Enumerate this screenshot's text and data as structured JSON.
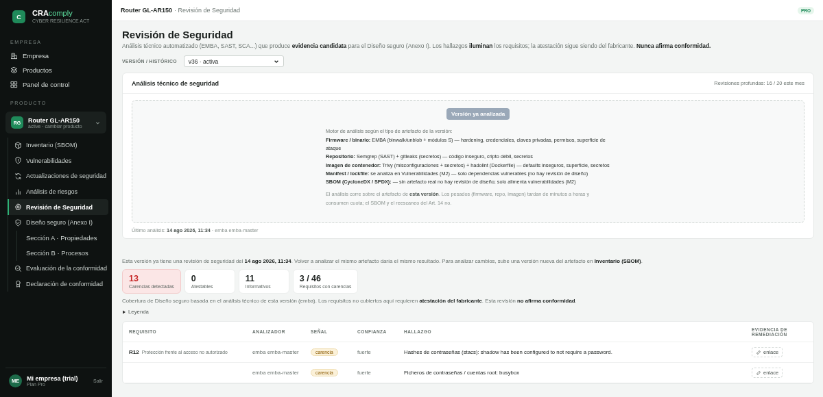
{
  "sidebar": {
    "logo": {
      "badge": "C",
      "brand_strong": "CRA",
      "brand_rest": "comply",
      "tagline": "CYBER RESILIENCE ACT"
    },
    "company_section": {
      "label": "EMPRESA",
      "items": [
        {
          "label": "Empresa",
          "selected": false
        },
        {
          "label": "Productos",
          "selected": false
        },
        {
          "label": "Panel de control",
          "selected": false
        }
      ]
    },
    "product_section": {
      "label": "PRODUCTO",
      "switcher": {
        "initials": "RG",
        "name": "Router GL-AR150",
        "status": "active · cambiar producto"
      },
      "items": [
        {
          "label": "Inventario (SBOM)",
          "selected": false
        },
        {
          "label": "Vulnerabilidades",
          "selected": false
        },
        {
          "label": "Actualizaciones de seguridad",
          "selected": false
        },
        {
          "label": "Análisis de riesgos",
          "selected": false
        },
        {
          "label": "Revisión de Seguridad",
          "selected": true
        },
        {
          "label": "Diseño seguro (Anexo I)",
          "selected": false,
          "children": [
            {
              "label": "Sección A · Propiedades",
              "selected": false
            },
            {
              "label": "Sección B · Procesos",
              "selected": false
            }
          ]
        },
        {
          "label": "Evaluación de la conformidad",
          "selected": false
        },
        {
          "label": "Declaración de conformidad",
          "selected": false
        }
      ]
    },
    "user": {
      "initials": "ME",
      "name": "Mi empresa (trial)",
      "plan": "Plan Pro",
      "logout": "Salir"
    }
  },
  "topbar": {
    "product": "Router GL-AR150",
    "page": "· Revisión de Seguridad",
    "plan_badge": "PRO"
  },
  "header": {
    "title": "Revisión de Seguridad",
    "description": "Análisis técnico automatizado (EMBA, SAST, SCA...) que produce **evidencia candidata** para el Diseño seguro (Anexo I). Los hallazgos **iluminan** los requisitos; la atestación sigue siendo del fabricante. **Nunca afirma conformidad.**"
  },
  "version": {
    "label": "VERSIÓN / HISTÓRICO",
    "value": "v36 · activa"
  },
  "analysis_card": {
    "title": "Análisis técnico de seguridad",
    "quota": "Revisiones profundas: 16 / 20 este mes",
    "button": {
      "label": "Versión ya analizada",
      "disabled": true
    },
    "intro": "Motor de análisis según el tipo de artefacto de la versión:",
    "engines": [
      {
        "name": "Firmware / binario:",
        "text": "EMBA (binwalk/unblob + módulos S) — hardening, credenciales, claves privadas, permisos, superficie de ataque"
      },
      {
        "name": "Repositorio:",
        "text": "Semgrep (SAST) + gitleaks (secretos) — código inseguro, cripto débil, secretos"
      },
      {
        "name": "Imagen de contenedor:",
        "text": "Trivy (misconfiguraciones + secretos) + hadolint (Dockerfile) — defaults inseguros, superficie, secretos"
      },
      {
        "name": "Manifest / lockfile:",
        "text": "se analiza en Vulnerabilidades (M2) — solo dependencias vulnerables (no hay revisión de diseño)"
      },
      {
        "name": "SBOM (CycloneDX / SPDX):",
        "text": "— sin artefacto real no hay revisión de diseño; solo alimenta vulnerabilidades (M2)"
      }
    ],
    "note": "El análisis corre sobre el artefacto de **esta versión**. Los pesados (firmware, repo, imagen) tardan de minutos a horas y consumen cuota; el SBOM y el reescaneo del Art. 14 no.",
    "last_analysis": "Último análisis: **14 ago 2026, 11:34** · emba emba-master"
  },
  "notice": "Esta versión ya tiene una revisión de seguridad del **14 ago 2026, 11:34**. Volver a analizar el mismo artefacto daría el mismo resultado. Para analizar cambios, sube una versión nueva del artefacto en **Inventario (SBOM)**.",
  "stats": [
    {
      "value": "13",
      "label": "Carencias detectadas",
      "kind": "alert"
    },
    {
      "value": "0",
      "label": "Atestables",
      "kind": "plain"
    },
    {
      "value": "11",
      "label": "Informativos",
      "kind": "plain"
    },
    {
      "value": "3 / 46",
      "label": "Requisitos con carencias",
      "kind": "plain"
    }
  ],
  "coverage_note": "Cobertura de Diseño seguro basada en el análisis técnico de esta versión (emba). Los requisitos no cubiertos aquí requieren **atestación del fabricante**. Esta revisión **no afirma conformidad**.",
  "legend": {
    "label": "Leyenda",
    "expanded": false
  },
  "table": {
    "columns": [
      "REQUISITO",
      "ANALIZADOR",
      "SEÑAL",
      "CONFIANZA",
      "HALLAZGO",
      "EVIDENCIA DE REMEDIACIÓN"
    ],
    "rows": [
      {
        "req_code": "R12",
        "req_name": "Protección frente al acceso no autorizado",
        "analyzer": "emba emba-master",
        "signal": "carencia",
        "confidence": "fuerte",
        "finding": "Hashes de contraseñas (stacs): shadow has been configured to not require a password.",
        "evidence": "enlace"
      },
      {
        "analyzer": "emba emba-master",
        "signal": "carencia",
        "confidence": "fuerte",
        "finding": "Ficheros de contraseñas / cuentas root: busybox",
        "evidence": "enlace"
      }
    ]
  }
}
